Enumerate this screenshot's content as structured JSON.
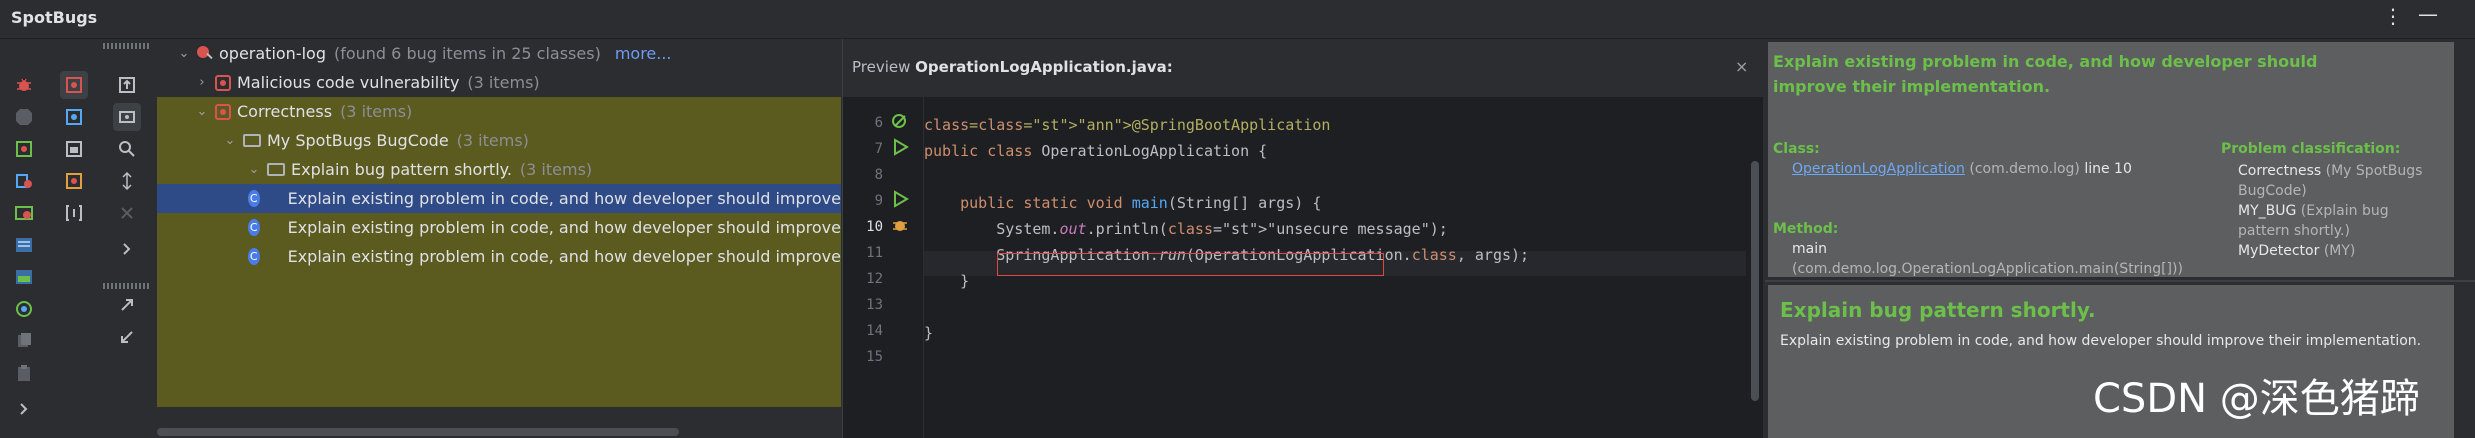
{
  "app": {
    "title": "SpotBugs"
  },
  "tree": {
    "root": {
      "label": "operation-log",
      "summary": "(found 6 bug items in 25 classes)",
      "more": "more..."
    },
    "items": [
      {
        "label": "Malicious code vulnerability",
        "count": "(3 items)"
      },
      {
        "label": "Correctness",
        "count": "(3 items)"
      },
      {
        "label": "My SpotBugs BugCode",
        "count": "(3 items)"
      },
      {
        "label": "Explain bug pattern shortly.",
        "count": "(3 items)"
      }
    ],
    "bugs": [
      "Explain existing problem in code, and how developer should improve",
      "Explain existing problem in code, and how developer should improve",
      "Explain existing problem in code, and how developer should improve"
    ],
    "class_icon_letter": "C"
  },
  "preview": {
    "label": "Preview",
    "file": "OperationLogApplication.java:",
    "close": "×",
    "lines": [
      {
        "num": "6",
        "text": "@SpringBootApplication"
      },
      {
        "num": "7",
        "text": "public class OperationLogApplication {"
      },
      {
        "num": "8",
        "text": ""
      },
      {
        "num": "9",
        "text": "    public static void main(String[] args) {"
      },
      {
        "num": "10",
        "text": "        System.out.println(\"unsecure message\");"
      },
      {
        "num": "11",
        "text": "        SpringApplication.run(OperationLogApplication.class, args);"
      },
      {
        "num": "12",
        "text": "    }"
      },
      {
        "num": "13",
        "text": ""
      },
      {
        "num": "14",
        "text": "}"
      },
      {
        "num": "15",
        "text": ""
      }
    ]
  },
  "details": {
    "heading": "Explain existing problem in code, and how developer should improve their implementation.",
    "class_label": "Class:",
    "class_name": "OperationLogApplication",
    "class_pkg": "(com.demo.log)",
    "class_line": "line 10",
    "method_label": "Method:",
    "method_name": "main",
    "method_sig": "(com.demo.log.OperationLogApplication.main(String[]))",
    "problem_label": "Problem classification:",
    "problem": [
      {
        "name": "Correctness",
        "note": "(My SpotBugs BugCode)"
      },
      {
        "name": "MY_BUG",
        "note": "(Explain bug pattern shortly.)"
      },
      {
        "name": "MyDetector",
        "note": "(MY)"
      }
    ],
    "pattern_title": "Explain bug pattern shortly.",
    "pattern_desc": "Explain existing problem in code, and how developer should improve their implementation."
  },
  "watermark": "CSDN @深色猪蹄",
  "colors": {
    "accent_green": "#6cc04a",
    "highlight_row": "#5b5a1f",
    "selected_row": "#2f4b87",
    "bug_red": "#d9534f"
  }
}
